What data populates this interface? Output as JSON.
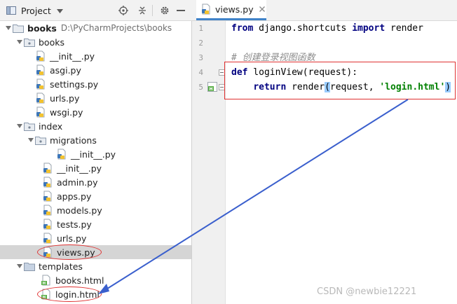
{
  "project_panel": {
    "title": "Project",
    "tree": [
      {
        "label": "books",
        "path": "D:\\PyCharmProjects\\books",
        "type": "root-folder"
      },
      {
        "label": "books",
        "type": "package"
      },
      {
        "label": "__init__.py",
        "type": "py"
      },
      {
        "label": "asgi.py",
        "type": "py"
      },
      {
        "label": "settings.py",
        "type": "py"
      },
      {
        "label": "urls.py",
        "type": "py"
      },
      {
        "label": "wsgi.py",
        "type": "py"
      },
      {
        "label": "index",
        "type": "package"
      },
      {
        "label": "migrations",
        "type": "package"
      },
      {
        "label": "__init__.py",
        "type": "py"
      },
      {
        "label": "__init__.py",
        "type": "py"
      },
      {
        "label": "admin.py",
        "type": "py"
      },
      {
        "label": "apps.py",
        "type": "py"
      },
      {
        "label": "models.py",
        "type": "py"
      },
      {
        "label": "tests.py",
        "type": "py"
      },
      {
        "label": "urls.py",
        "type": "py"
      },
      {
        "label": "views.py",
        "type": "py",
        "selected": true
      },
      {
        "label": "templates",
        "type": "folder"
      },
      {
        "label": "books.html",
        "type": "html"
      },
      {
        "label": "login.html",
        "type": "html"
      }
    ]
  },
  "editor": {
    "active_tab": "views.py",
    "line_numbers": [
      "1",
      "2",
      "3",
      "4",
      "5"
    ],
    "code": {
      "l1_kw1": "from",
      "l1_mod": " django.shortcuts ",
      "l1_kw2": "import",
      "l1_name": " render",
      "l3_comment": "# 创建登录视图函数",
      "l4_kw": "def",
      "l4_rest": " loginView(request):",
      "l5_indent": "    ",
      "l5_kw": "return",
      "l5_call": " render",
      "l5_open": "(",
      "l5_args": "request, ",
      "l5_str": "'login.html'",
      "l5_close": ")"
    }
  },
  "colors": {
    "annotation_red": "#e03131",
    "arrow_blue": "#3a5fcd",
    "keyword": "#000080",
    "string": "#008000"
  },
  "watermark": "CSDN @newbie12221"
}
